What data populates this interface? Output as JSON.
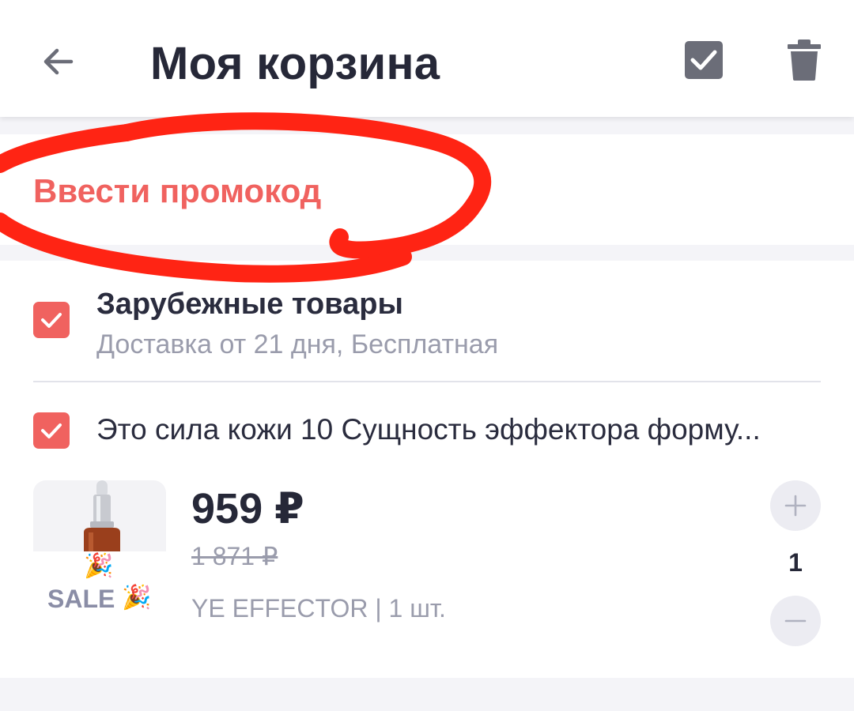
{
  "header": {
    "title": "Моя корзина",
    "back_icon": "arrow-left-icon",
    "select_all_icon": "checkbox-checked-icon",
    "delete_icon": "trash-icon"
  },
  "promo": {
    "label": "Ввести промокод"
  },
  "cart_group": {
    "title": "Зарубежные товары",
    "subtitle": "Доставка от 21 дня, Бесплатная",
    "checked": true
  },
  "cart_item": {
    "title": "Это сила кожи 10 Сущность эффектора форму...",
    "checked": true,
    "price": "959 ₽",
    "old_price": "1 871 ₽",
    "brand_qty": "YE EFFECTOR | 1 шт.",
    "quantity": "1",
    "badge": {
      "text": "SALE",
      "icon": "party-popper-icon"
    }
  },
  "colors": {
    "accent": "#f0625f",
    "text_primary": "#262838",
    "text_secondary": "#9a9cac",
    "annotation": "#ff2414"
  }
}
